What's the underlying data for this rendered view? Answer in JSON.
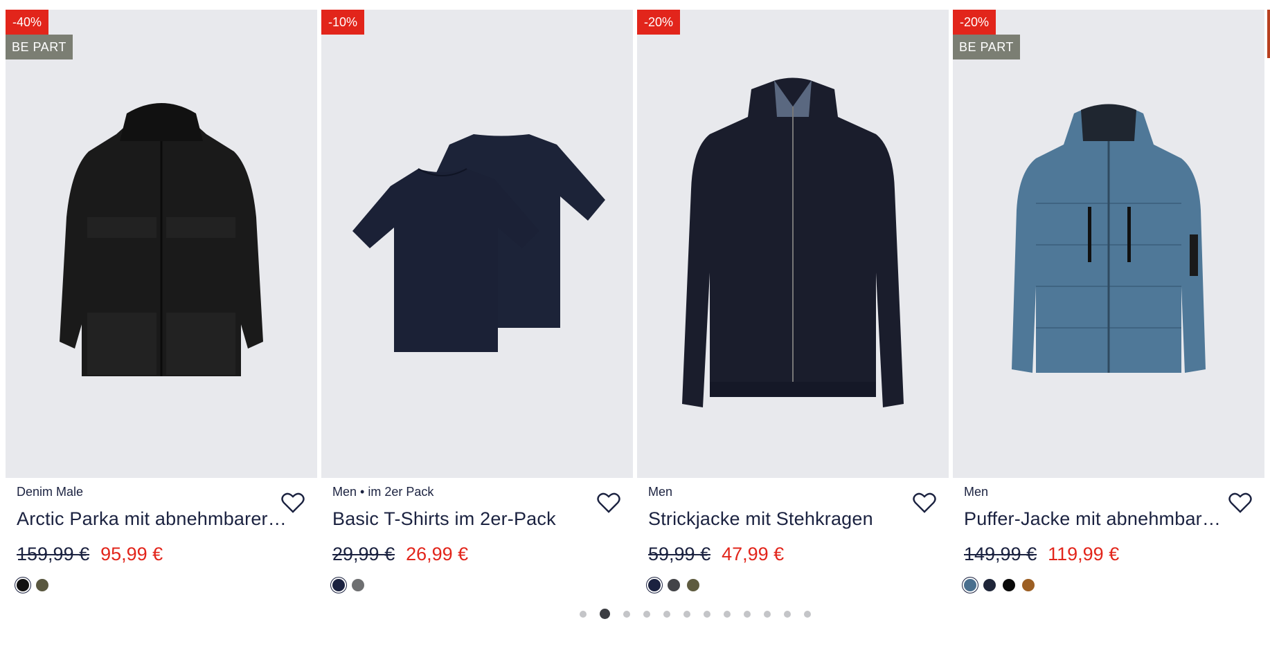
{
  "products": [
    {
      "discount": "-40%",
      "badge": "BE PART",
      "brand": "Denim Male",
      "name": "Arctic Parka mit abnehmbarer…",
      "old_price": "159,99 €",
      "new_price": "95,99 €",
      "colors": [
        "#111111",
        "#59573f"
      ],
      "selected": 0
    },
    {
      "discount": "-10%",
      "badge": "",
      "brand": "Men • im 2er Pack",
      "name": "Basic T-Shirts im 2er-Pack",
      "old_price": "29,99 €",
      "new_price": "26,99 €",
      "colors": [
        "#1b2240",
        "#6e6f71"
      ],
      "selected": 0
    },
    {
      "discount": "-20%",
      "badge": "",
      "brand": "Men",
      "name": "Strickjacke mit Stehkragen",
      "old_price": "59,99 €",
      "new_price": "47,99 €",
      "colors": [
        "#1b2240",
        "#434448",
        "#5e5b3f"
      ],
      "selected": 0
    },
    {
      "discount": "-20%",
      "badge": "BE PART",
      "brand": "Men",
      "name": "Puffer-Jacke mit abnehmbar…",
      "old_price": "149,99 €",
      "new_price": "119,99 €",
      "colors": [
        "#4a6f8e",
        "#1f2639",
        "#0a0a0a",
        "#9c5f24"
      ],
      "selected": 0
    }
  ],
  "pagination": {
    "count": 12,
    "active": 1
  },
  "colors": {
    "sale_red": "#e2251b",
    "badge_grey": "#7b7e73",
    "text_navy": "#1b2240",
    "image_bg": "#e8e9ed"
  }
}
